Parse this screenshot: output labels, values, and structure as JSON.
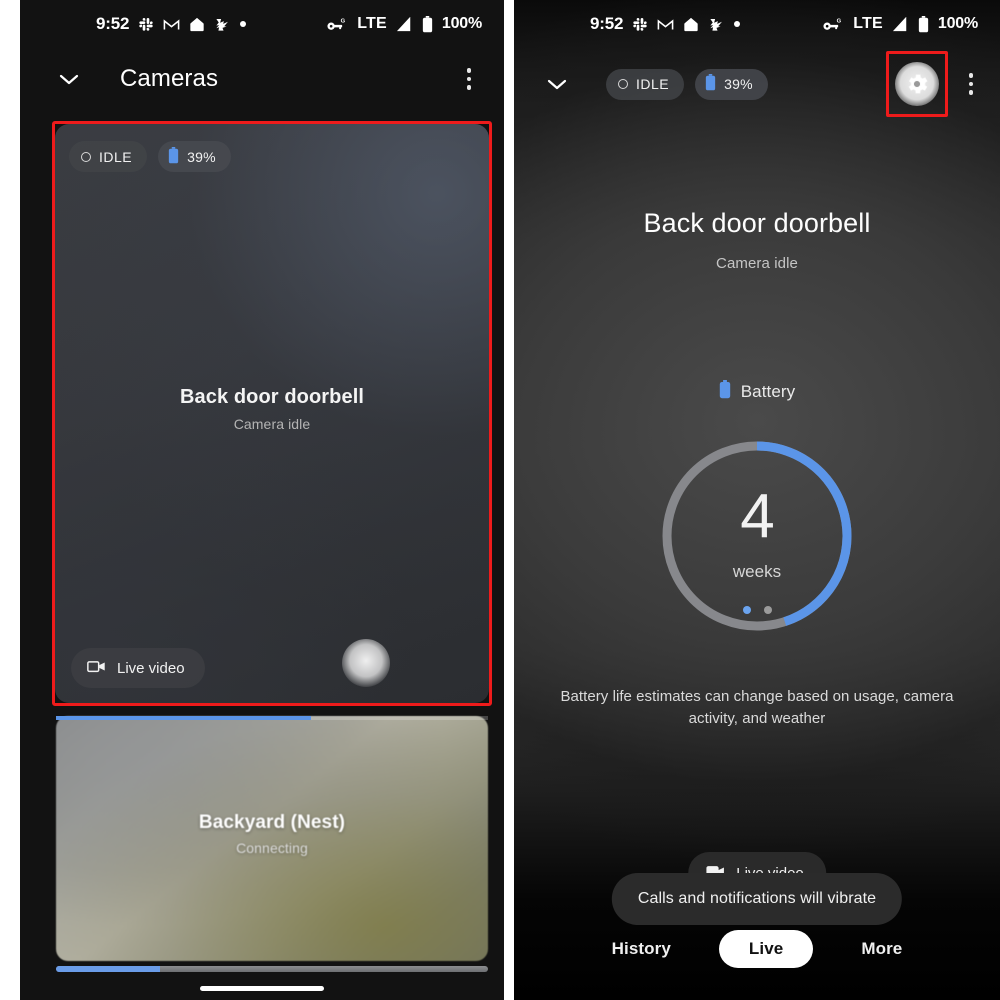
{
  "status_bar": {
    "time": "9:52",
    "left_icons": [
      "slack-icon",
      "gmail-icon",
      "nest-home-icon",
      "app-icon",
      "dot-icon"
    ],
    "network": "LTE",
    "network_superscript": "G",
    "battery_percent": "100%",
    "right_icons": [
      "key-g-icon",
      "signal-icon",
      "battery-icon"
    ]
  },
  "left_panel": {
    "appbar": {
      "chevron_icon": "chevron-down-icon",
      "title": "Cameras",
      "overflow_icon": "kebab-menu-icon"
    },
    "camera_card": {
      "badges": {
        "status_label": "IDLE",
        "status_icon": "idle-circle-icon",
        "battery_label": "39%",
        "battery_icon": "battery-icon"
      },
      "name": "Back door doorbell",
      "subtitle": "Camera idle",
      "live_button_label": "Live video",
      "live_button_icon": "video-camera-icon",
      "highlighted": true,
      "highlight_color": "#ee1b1b"
    },
    "camera_card_2": {
      "name": "Backyard (Nest)",
      "subtitle": "Connecting",
      "progress_percent": 59,
      "progress_color": "#5b95e8"
    },
    "bottom_progress_percent": 24
  },
  "right_panel": {
    "appbar": {
      "chevron_icon": "chevron-down-icon",
      "status_label": "IDLE",
      "status_icon": "idle-circle-icon",
      "battery_label": "39%",
      "battery_icon": "battery-icon",
      "settings_icon": "gear-icon",
      "settings_highlighted": true,
      "highlight_color": "#ee1b1b",
      "overflow_icon": "kebab-menu-icon"
    },
    "title": "Back door doorbell",
    "subtitle": "Camera idle",
    "battery_section": {
      "heading": "Battery",
      "heading_icon": "battery-icon",
      "value": "4",
      "unit": "weeks",
      "ring_percent": 45,
      "ring_color": "#5b95e8",
      "ring_track_color": "#87888c",
      "pager_dots": 2,
      "pager_active_index": 0,
      "note": "Battery life estimates can change based on usage, camera activity, and weather"
    },
    "live_button_label": "Live video",
    "live_button_icon": "video-camera-icon",
    "toast": "Calls and notifications will vibrate",
    "nav": [
      {
        "label": "History",
        "selected": false
      },
      {
        "label": "Live",
        "selected": true
      },
      {
        "label": "More",
        "selected": false
      }
    ]
  }
}
